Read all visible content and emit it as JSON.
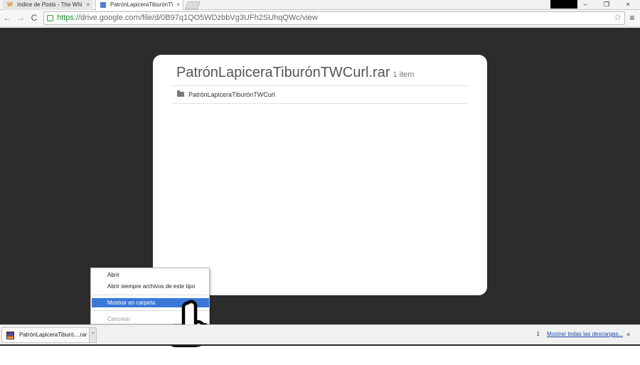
{
  "tabs": [
    {
      "favicon": "W",
      "label": "Indice de Posts - The Whi",
      "close": "×"
    },
    {
      "favicon": "",
      "label": "PatrónLapiceraTiburónTW",
      "close": "×"
    }
  ],
  "window": {
    "minimize": "–",
    "restore": "❐",
    "close": "×"
  },
  "toolbar": {
    "back": "←",
    "forward": "→",
    "reload": "C",
    "url_scheme": "https://",
    "url_rest": "drive.google.com/file/d/0B97q1QO5WDzbbVg3UFh2SUhqQWc/view",
    "star": "☆",
    "menu": "≡"
  },
  "viewer": {
    "title": "PatrónLapiceraTiburónTWCurl.rar",
    "count": "1 item",
    "entries": [
      {
        "name": "PatrónLapiceraTiburónTWCurl"
      }
    ]
  },
  "context_menu": {
    "items": [
      {
        "label": "Abrir",
        "state": "normal"
      },
      {
        "label": "Abrir siempre archivos de este tipo",
        "state": "normal"
      },
      {
        "label": "Mostrar en carpeta",
        "state": "highlighted"
      },
      {
        "label": "Cancelar",
        "state": "disabled"
      }
    ]
  },
  "download_shelf": {
    "file_label": "PatrónLapiceraTiburó....rar",
    "arrow": "⌃",
    "show_all": "Mostrar todas las descargas...",
    "close": "×"
  },
  "colors": {
    "viewer_bg": "#2c2c2c",
    "highlight": "#3b78d8",
    "secure_green": "#1f8a2f",
    "link_blue": "#1a4aa8"
  }
}
